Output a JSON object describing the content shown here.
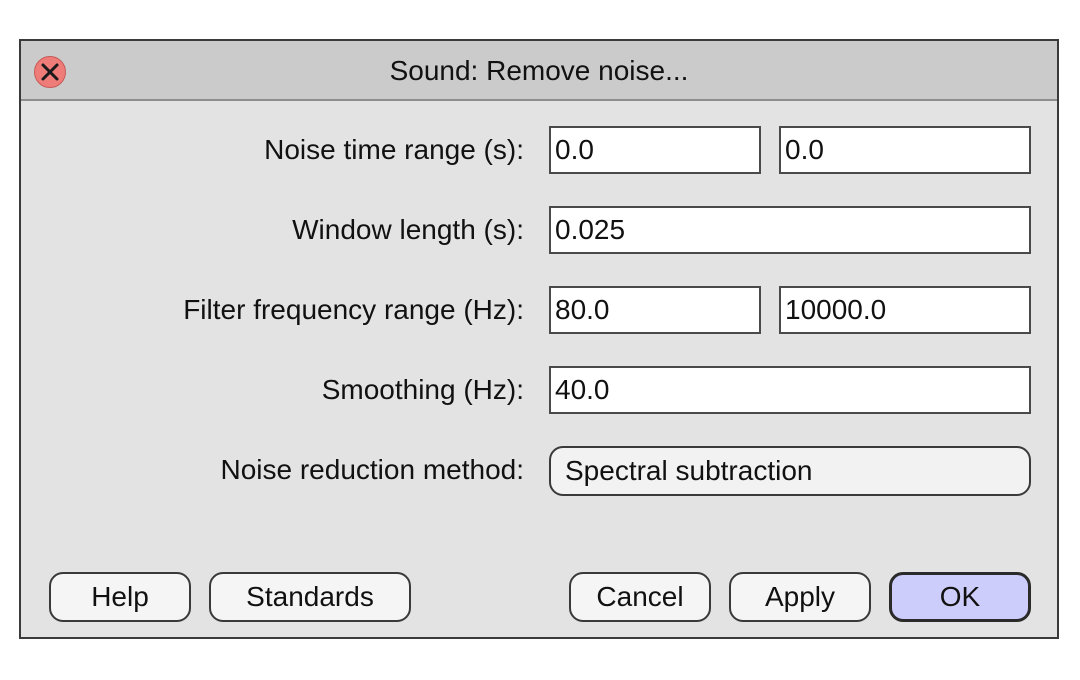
{
  "window": {
    "title": "Sound: Remove noise..."
  },
  "fields": {
    "noise_time_range_label": "Noise time range (s):",
    "noise_time_from": "0.0",
    "noise_time_to": "0.0",
    "window_length_label": "Window length (s):",
    "window_length": "0.025",
    "filter_frequency_range_label": "Filter frequency range (Hz):",
    "filter_freq_from": "80.0",
    "filter_freq_to": "10000.0",
    "smoothing_label": "Smoothing (Hz):",
    "smoothing": "40.0",
    "noise_reduction_method_label": "Noise reduction method:",
    "noise_reduction_method": "Spectral subtraction"
  },
  "buttons": {
    "help": "Help",
    "standards": "Standards",
    "cancel": "Cancel",
    "apply": "Apply",
    "ok": "OK"
  },
  "icons": {
    "close": "close-icon"
  },
  "colors": {
    "close_button": "#ee7d79",
    "ok_button": "#cdcdfb",
    "dialog_background": "#e3e3e3",
    "titlebar_background": "#cbcbcb"
  }
}
